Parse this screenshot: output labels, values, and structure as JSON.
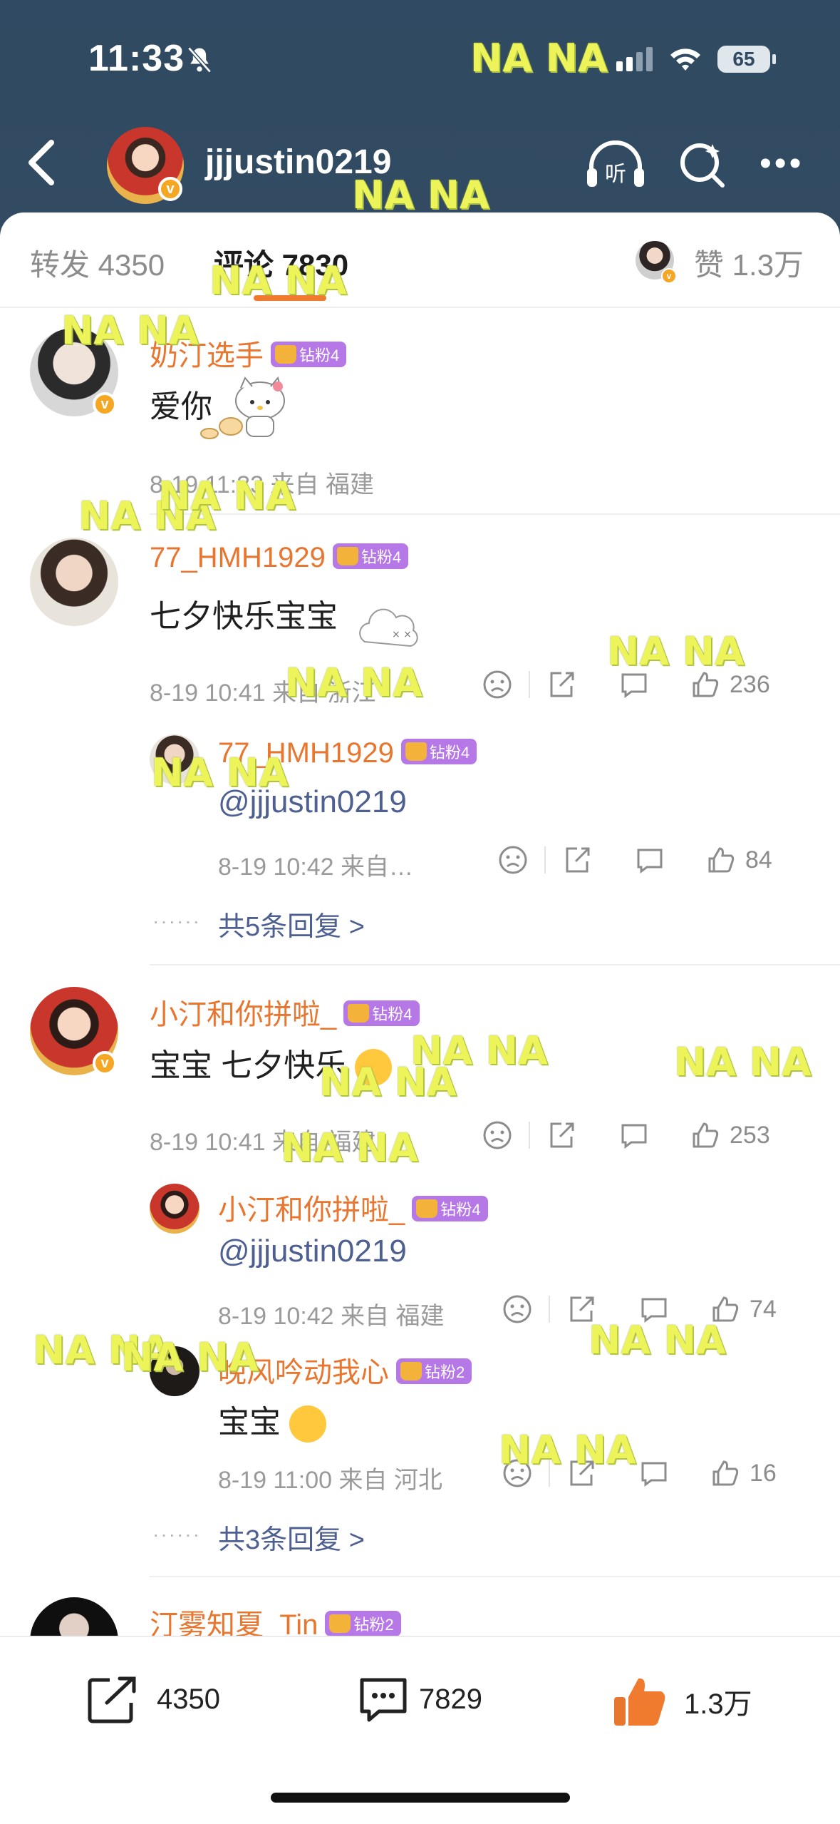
{
  "status_bar": {
    "time": "11:33",
    "battery": "65"
  },
  "nav": {
    "title": "jjjustin0219",
    "listen_icon_label": "听"
  },
  "tabs": {
    "repost": "转发 4350",
    "comments": "评论 7830",
    "likes": "赞 1.3万"
  },
  "watermark": "NA NA",
  "comments": [
    {
      "name": "奶汀选手",
      "badge": "钻粉4",
      "text": "爱你",
      "meta": "8-19 11:33  来自 福建"
    },
    {
      "name": "77_HMH1929",
      "badge": "钻粉4",
      "text": "七夕快乐宝宝",
      "meta": "8-19 10:41  来自 浙江",
      "likes": "236",
      "replies": [
        {
          "name": "77_HMH1929",
          "badge": "钻粉4",
          "text": "@jjjustin0219",
          "meta": "8-19 10:42  来自…",
          "likes": "84"
        }
      ],
      "more_replies": "共5条回复 >"
    },
    {
      "name": "小汀和你拼啦_",
      "badge": "钻粉4",
      "text": "宝宝 七夕快乐",
      "meta": "8-19 10:41  来自 福建",
      "likes": "253",
      "replies": [
        {
          "name": "小汀和你拼啦_",
          "badge": "钻粉4",
          "text": "@jjjustin0219",
          "meta": "8-19 10:42  来自 福建",
          "likes": "74"
        },
        {
          "name": "晚风吟动我心",
          "badge": "钻粉2",
          "text": "宝宝",
          "meta": "8-19 11:00  来自 河北",
          "likes": "16"
        }
      ],
      "more_replies": "共3条回复 >"
    },
    {
      "name": "汀雾知夏_Tin",
      "badge": "钻粉2"
    }
  ],
  "bottom_bar": {
    "reposts": "4350",
    "comments": "7829",
    "likes": "1.3万"
  },
  "colors": {
    "header_bg": "#2f4a62",
    "name_orange": "#e8762f",
    "mention_blue": "#4e5f91",
    "badge_purple": "#b678e6",
    "like_orange": "#f07b2f"
  }
}
